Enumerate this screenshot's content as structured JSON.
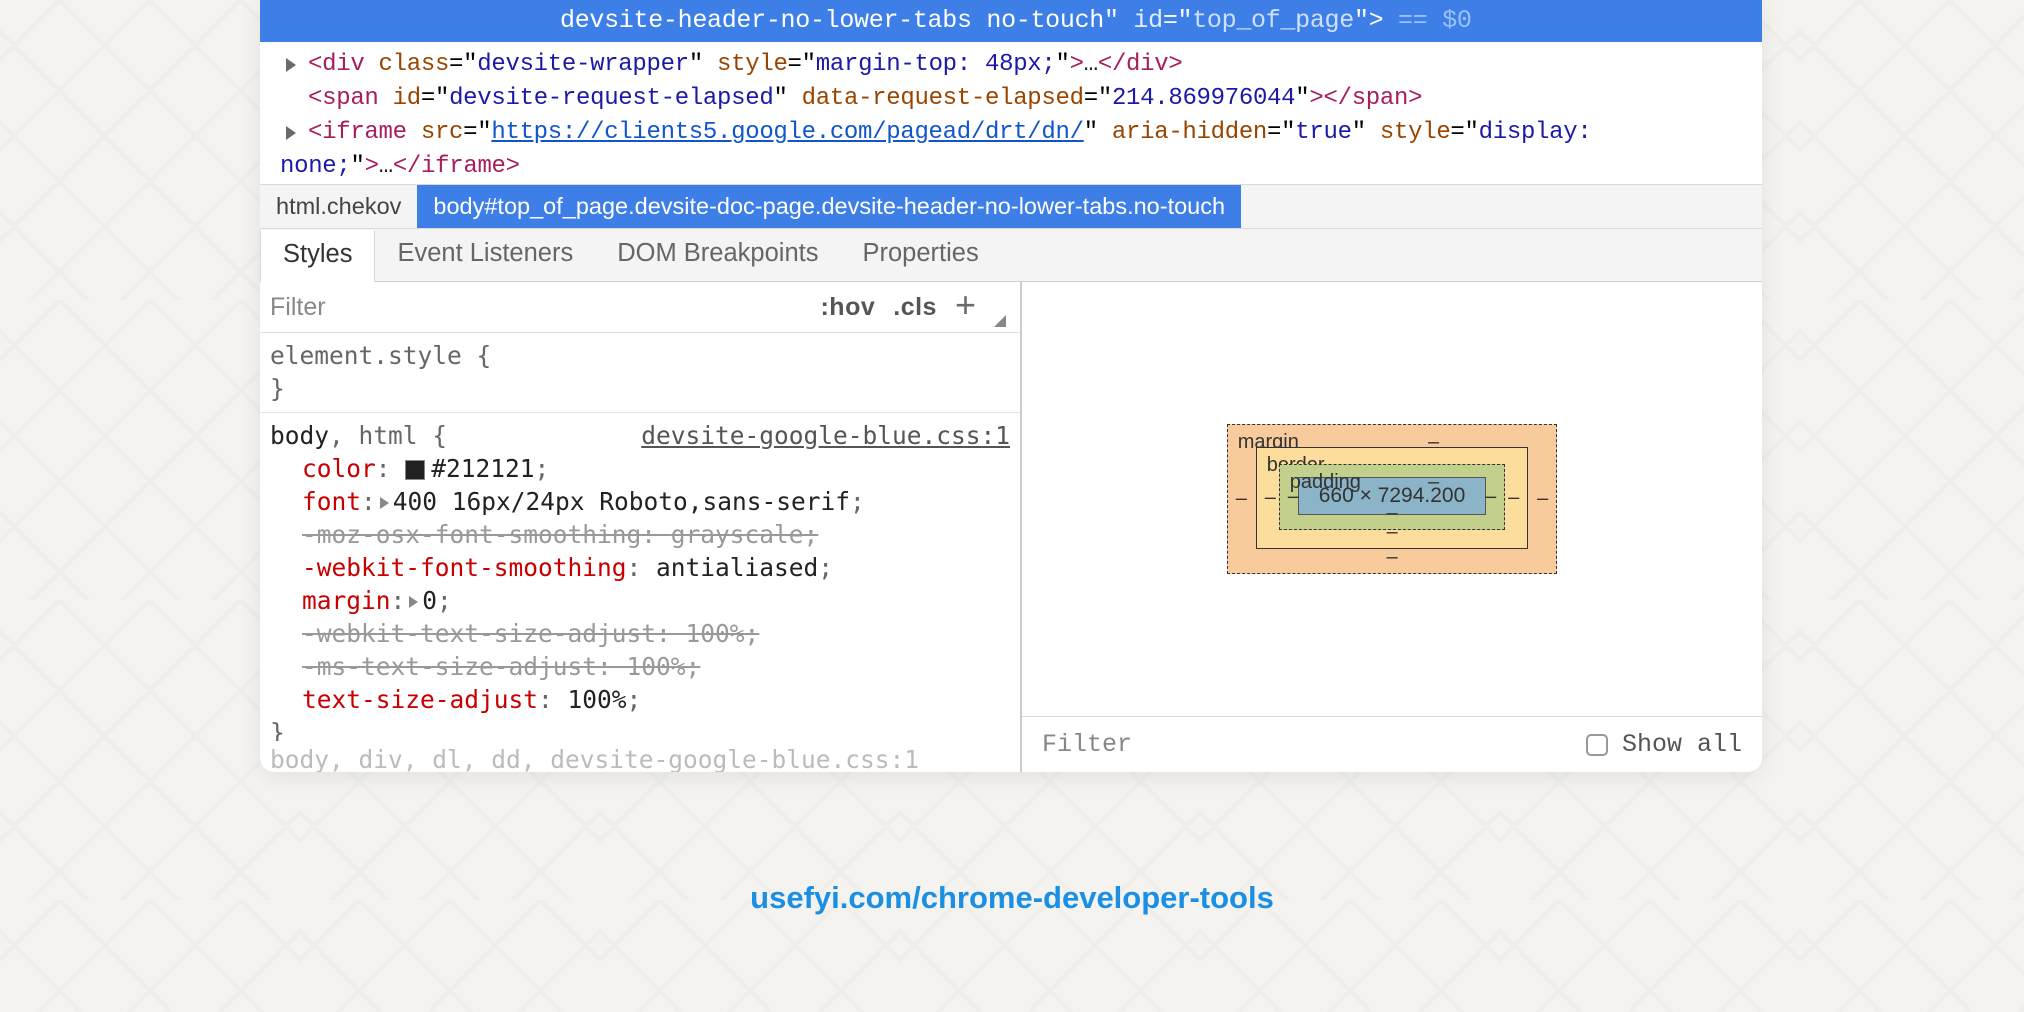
{
  "highlight": {
    "prefix_classes": "devsite-header-no-lower-tabs no-touch",
    "id_attr": "id",
    "id_val": "top_of_page",
    "suffix": " == $0"
  },
  "dom": {
    "div": {
      "tag": "div",
      "class_attr": "class",
      "class_val": "devsite-wrapper",
      "style_attr": "style",
      "style_val": "margin-top: 48px;",
      "ell": "…",
      "close": "</div>"
    },
    "span": {
      "tag": "span",
      "id_attr": "id",
      "id_val": "devsite-request-elapsed",
      "data_attr": "data-request-elapsed",
      "data_val": "214.869976044",
      "close": "</span>"
    },
    "iframe": {
      "tag": "iframe",
      "src_attr": "src",
      "src_val": "https://clients5.google.com/pagead/drt/dn/",
      "aria_attr": "aria-hidden",
      "aria_val": "true",
      "style_attr": "style",
      "style_val": "display:",
      "style_val2": "none;",
      "ell": "…",
      "close": "</iframe>"
    }
  },
  "breadcrumb": {
    "first": "html.chekov",
    "second": "body#top_of_page.devsite-doc-page.devsite-header-no-lower-tabs.no-touch"
  },
  "tabs": {
    "styles": "Styles",
    "events": "Event Listeners",
    "dom": "DOM Breakpoints",
    "props": "Properties"
  },
  "styles": {
    "filter": "Filter",
    "hov": ":hov",
    "cls": ".cls",
    "element_style": "element.style {",
    "close_brace": "}",
    "rule2_sel_match": "body",
    "rule2_sel_rest": ", html {",
    "rule2_src": "devsite-google-blue.css:1",
    "d_color_p": "color",
    "d_color_v": "#212121",
    "d_font_p": "font",
    "d_font_v": "400 16px/24px Roboto,sans-serif",
    "d_moz_p": "-moz-osx-font-smoothing",
    "d_moz_v": "grayscale",
    "d_wfs_p": "-webkit-font-smoothing",
    "d_wfs_v": "antialiased",
    "d_margin_p": "margin",
    "d_margin_v": "0",
    "d_wtsa_p": "-webkit-text-size-adjust",
    "d_wtsa_v": "100%",
    "d_mstsa_p": "-ms-text-size-adjust",
    "d_mstsa_v": "100%",
    "d_tsa_p": "text-size-adjust",
    "d_tsa_v": "100%",
    "fade": "body, div, dl, dd,          devsite-google-blue.css:1"
  },
  "boxmodel": {
    "margin": "margin",
    "border": "border",
    "padding": "padding",
    "content": "660 × 7294.200",
    "dash": "–"
  },
  "boxfilter": {
    "filter": "Filter",
    "showall": "Show all"
  },
  "caption": "usefyi.com/chrome-developer-tools"
}
